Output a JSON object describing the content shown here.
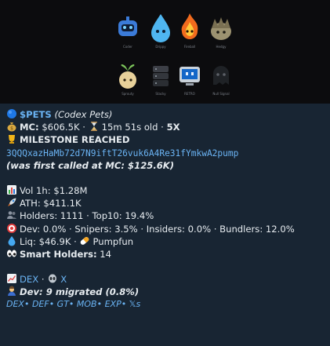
{
  "banner": {
    "pets": [
      {
        "name": "Coder",
        "icon": "robot-icon"
      },
      {
        "name": "Drippy",
        "icon": "water-drop-icon"
      },
      {
        "name": "Fireball",
        "icon": "fire-icon"
      },
      {
        "name": "Hedgy",
        "icon": "hedgehog-icon"
      },
      {
        "name": "Sprouty",
        "icon": "seed-icon"
      },
      {
        "name": "Stacky",
        "icon": "server-stack-icon"
      },
      {
        "name": "RETRO",
        "icon": "computer-icon"
      },
      {
        "name": "Null Signal",
        "icon": "ghost-icon"
      }
    ]
  },
  "token": {
    "ticker": "$PETS",
    "name": "(Codex Pets)",
    "mc_label": "MC:",
    "mc_value": "$606.5K",
    "age": "15m 51s old",
    "multiplier": "5X",
    "milestone": "MILESTONE REACHED",
    "address": "3QQQxazHaMb72d7N9iftT26vuk6A4Re31fYmkwA2pump",
    "first_called": "(was first called at MC: $125.6K)"
  },
  "stats": {
    "vol": "Vol 1h: $1.28M",
    "ath": "ATH: $411.1K",
    "holders": "Holders: 1111 · Top10: 19.4%",
    "dev_line": "Dev: 0.0% · Snipers: 3.5% · Insiders: 0.0% · Bundlers: 12.0%",
    "liq": "Liq: $46.9K ·",
    "platform": "Pumpfun",
    "smart_label": "Smart Holders:",
    "smart_value": "14"
  },
  "links": {
    "dex": "DEX",
    "x": "X",
    "dev_migrated": "Dev: 9 migrated (0.8%)",
    "footer": "DEX• DEF• GT• MOB• EXP• 𝕏s"
  }
}
